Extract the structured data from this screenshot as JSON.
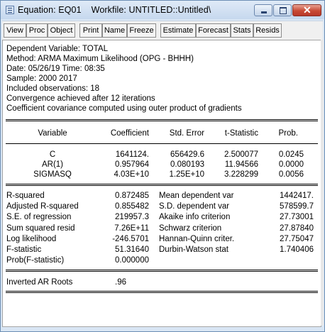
{
  "window": {
    "title_prefix": "Equation: EQ01",
    "title_workfile": "Workfile: UNTITLED::Untitled\\",
    "close_glyph": "✕"
  },
  "toolbar": {
    "buttons": [
      "View",
      "Proc",
      "Object",
      "Print",
      "Name",
      "Freeze",
      "Estimate",
      "Forecast",
      "Stats",
      "Resids"
    ]
  },
  "header_lines": [
    "Dependent Variable: TOTAL",
    "Method: ARMA Maximum Likelihood (OPG - BHHH)",
    "Date: 05/26/19   Time: 08:35",
    "Sample: 2000 2017",
    "Included observations: 18",
    "Convergence achieved after 12 iterations",
    "Coefficient covariance computed using outer product of gradients"
  ],
  "coef_table": {
    "headers": [
      "Variable",
      "Coefficient",
      "Std. Error",
      "t-Statistic",
      "Prob."
    ],
    "rows": [
      [
        "C",
        "1641124.",
        "656429.6",
        "2.500077",
        "0.0245"
      ],
      [
        "AR(1)",
        "0.957964",
        "0.080193",
        "11.94566",
        "0.0000"
      ],
      [
        "SIGMASQ",
        "4.03E+10",
        "1.25E+10",
        "3.228299",
        "0.0056"
      ]
    ]
  },
  "stats": {
    "left": [
      [
        "R-squared",
        "0.872485"
      ],
      [
        "Adjusted R-squared",
        "0.855482"
      ],
      [
        "S.E. of regression",
        "219957.3"
      ],
      [
        "Sum squared resid",
        "7.26E+11"
      ],
      [
        "Log likelihood",
        "-246.5701"
      ],
      [
        "F-statistic",
        "51.31640"
      ],
      [
        "Prob(F-statistic)",
        "0.000000"
      ]
    ],
    "right": [
      [
        "Mean dependent var",
        "1442417."
      ],
      [
        "S.D. dependent var",
        "578599.7"
      ],
      [
        "Akaike info criterion",
        "27.73001"
      ],
      [
        "Schwarz criterion",
        "27.87840"
      ],
      [
        "Hannan-Quinn criter.",
        "27.75047"
      ],
      [
        "Durbin-Watson stat",
        "1.740406"
      ]
    ]
  },
  "roots": {
    "label": "Inverted AR Roots",
    "value": ".96"
  }
}
